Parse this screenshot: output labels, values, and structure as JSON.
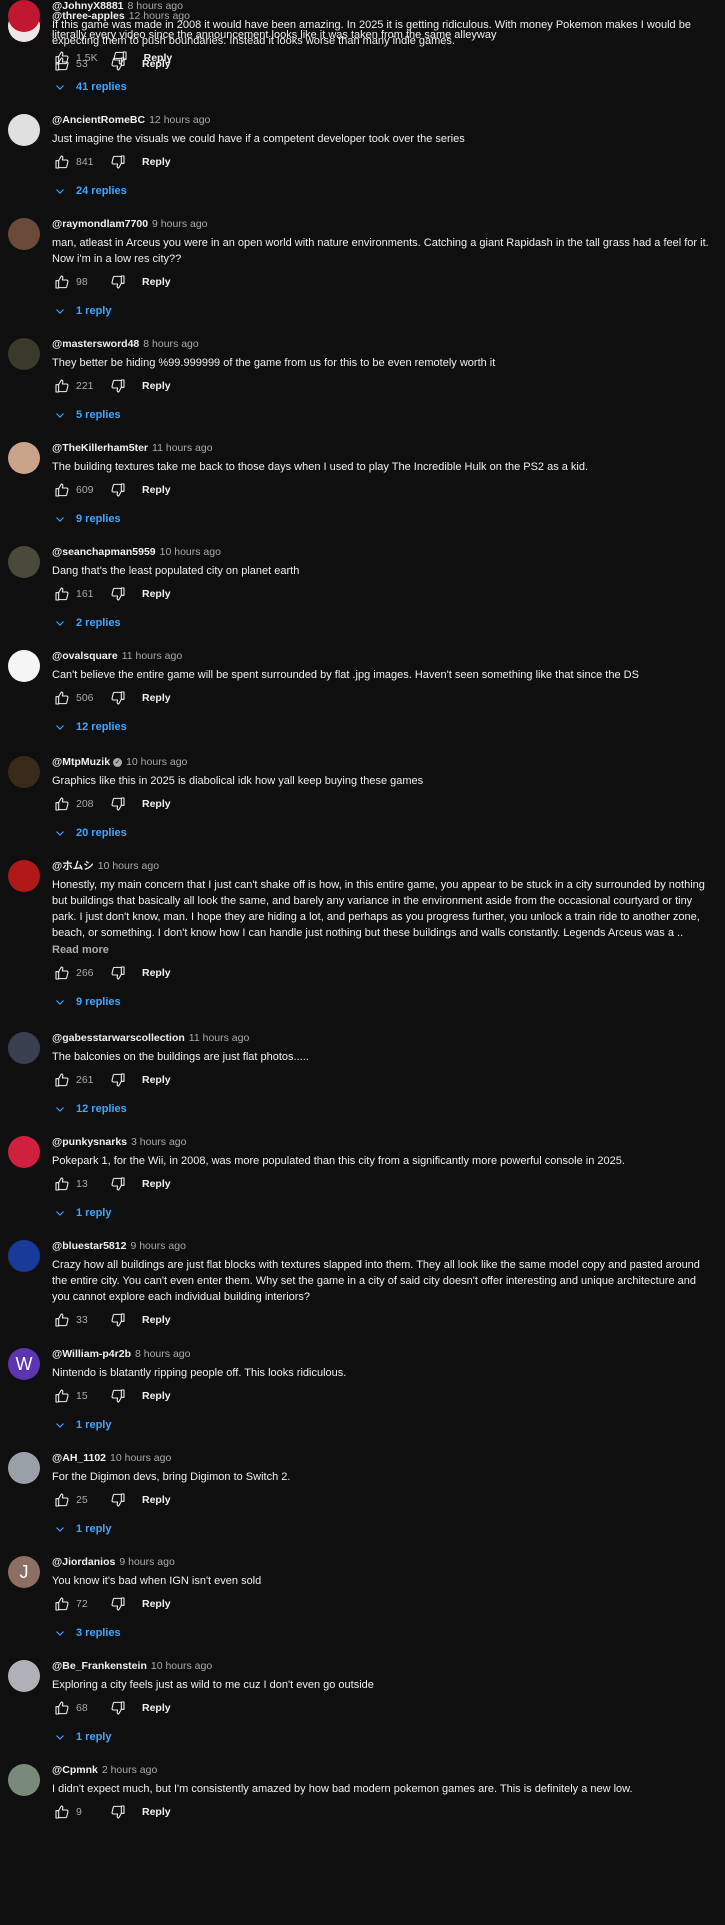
{
  "colors": {
    "background": "#0f0f0f",
    "link": "#3ea6ff",
    "muted": "#aaaaaa"
  },
  "reply_button_label": "Reply",
  "read_more_label": "Read more",
  "comments": [
    {
      "author": "@three-apples",
      "time": "12 hours ago",
      "text": "literally every video since the announcement looks like it was taken from the same alleyway",
      "likes": "1.5K",
      "replies": "41 replies",
      "avatar_color": "#f0e6e8",
      "avatar_letter": ""
    },
    {
      "author": "@AncientRomeBC",
      "time": "12 hours ago",
      "text": "Just imagine the visuals we could have if a competent developer took over the series",
      "likes": "841",
      "replies": "24 replies",
      "avatar_color": "#e0e0e0",
      "avatar_letter": ""
    },
    {
      "author": "@raymondlam7700",
      "time": "9 hours ago",
      "text": "man, atleast in Arceus you were in an open world with nature environments. Catching a giant Rapidash in the tall grass had a feel for it. Now i'm in a low res city??",
      "likes": "98",
      "replies": "1 reply",
      "avatar_color": "#6b4a3a",
      "avatar_letter": ""
    },
    {
      "author": "@mastersword48",
      "time": "8 hours ago",
      "text": "They better be hiding %99.999999 of the game from us for this to be even remotely worth it",
      "likes": "221",
      "replies": "5 replies",
      "avatar_color": "#3a3a2a",
      "avatar_letter": ""
    },
    {
      "author": "@TheKillerham5ter",
      "time": "11 hours ago",
      "text": "The building textures take me back to those days when I used to play The Incredible Hulk on the PS2 as a kid.",
      "likes": "609",
      "replies": "9 replies",
      "avatar_color": "#c9a48a",
      "avatar_letter": ""
    },
    {
      "author": "@seanchapman5959",
      "time": "10 hours ago",
      "text": "Dang that's the least populated city on planet earth",
      "likes": "161",
      "replies": "2 replies",
      "avatar_color": "#4a4a3a",
      "avatar_letter": ""
    },
    {
      "author": "@ovalsquare",
      "time": "11 hours ago",
      "text": "Can't believe the entire game will be spent surrounded by flat .jpg images. Haven't seen something like that since the DS",
      "likes": "506",
      "replies": "12 replies",
      "avatar_color": "#f5f5f5",
      "avatar_letter": ""
    },
    {
      "author": "@MtpMuzik",
      "time": "10 hours ago",
      "text": "Graphics like this in 2025 is diabolical idk how yall keep buying these games",
      "likes": "208",
      "replies": "20 replies",
      "avatar_color": "#3a2a1a",
      "avatar_letter": "",
      "verified": true
    },
    {
      "author": "@ホムシ",
      "time": "10 hours ago",
      "text": "Honestly, my main concern that I just can't shake off is how, in this entire game, you appear to be stuck in a city surrounded by nothing but buildings that basically all look the same, and barely any variance in the environment aside from the occasional courtyard or tiny park.  I just don't know, man.  I hope they are hiding a lot, and perhaps as you progress further, you unlock a train ride to another zone, beach, or something. I don't know how I can handle just nothing but these buildings and walls constantly.  Legends Arceus was a ..",
      "likes": "266",
      "replies": "9 replies",
      "avatar_color": "#b01818",
      "avatar_letter": "",
      "read_more": true
    },
    {
      "author": "@gabesstarwarscollection",
      "time": "11 hours ago",
      "text": "The balconies on the buildings are just flat photos.....",
      "likes": "261",
      "replies": "12 replies",
      "avatar_color": "#3a4050",
      "avatar_letter": ""
    },
    {
      "author": "@punkysnarks",
      "time": "3 hours ago",
      "text": "Pokepark 1, for the Wii, in 2008, was more populated than this city from a significantly more powerful console in 2025.",
      "likes": "13",
      "replies": "1 reply",
      "avatar_color": "#d02040",
      "avatar_letter": ""
    },
    {
      "author": "@bluestar5812",
      "time": "9 hours ago",
      "text": "Crazy how all buildings are just flat blocks with textures slapped into them. They all look like the same model copy and pasted around the entire city. You can't even enter them. Why set the game in a city of said city doesn't offer interesting and unique architecture and you cannot explore each individual building interiors?",
      "likes": "33",
      "replies": "",
      "avatar_color": "#1a3a9a",
      "avatar_letter": ""
    },
    {
      "author": "@William-p4r2b",
      "time": "8 hours ago",
      "text": "Nintendo is blatantly ripping people off. This looks ridiculous.",
      "likes": "15",
      "replies": "1 reply",
      "avatar_color": "#5e35b1",
      "avatar_letter": "W"
    },
    {
      "author": "@AH_1102",
      "time": "10 hours ago",
      "text": "For the Digimon devs, bring Digimon to Switch 2.",
      "likes": "25",
      "replies": "1 reply",
      "avatar_color": "#9aa0a8",
      "avatar_letter": ""
    },
    {
      "author": "@Jiordanios",
      "time": "9 hours ago",
      "text": "You know it's bad when IGN isn't even sold",
      "likes": "72",
      "replies": "3 replies",
      "avatar_color": "#8d6e63",
      "avatar_letter": "J"
    },
    {
      "author": "@Be_Frankenstein",
      "time": "10 hours ago",
      "text": "Exploring a city feels just as wild to me cuz I don't even go outside",
      "likes": "68",
      "replies": "1 reply",
      "avatar_color": "#b0b0b8",
      "avatar_letter": ""
    },
    {
      "author": "@Cpmnk",
      "time": "2 hours ago",
      "text": "I didn't expect much, but I'm consistently amazed by how bad modern pokemon games are. This is definitely a new low.",
      "likes": "9",
      "replies": "",
      "avatar_color": "#7a8a7a",
      "avatar_letter": ""
    },
    {
      "author": "@JohnyX8881",
      "time": "8 hours ago",
      "text": "If this game was made in 2008 it would have been amazing. In 2025 it is getting ridiculous. With money Pokemon makes I would be expecting them to push boundaries. Instead it looks worse than many indie games.",
      "likes": "53",
      "replies": "",
      "avatar_color": "#c01830",
      "avatar_letter": ""
    }
  ]
}
